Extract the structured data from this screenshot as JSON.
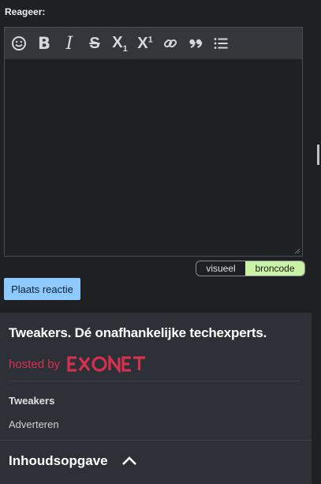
{
  "comment": {
    "label": "Reageer:",
    "toolbar_icons": [
      "emoji-icon",
      "bold-icon",
      "italic-icon",
      "strikethrough-icon",
      "subscript-icon",
      "superscript-icon",
      "link-icon",
      "quote-icon",
      "bulleted-list-icon"
    ],
    "subscript_glyph": "X",
    "subscript_index": "1",
    "superscript_glyph": "X",
    "superscript_index": "1",
    "bold_glyph": "B",
    "italic_glyph": "I",
    "strike_glyph": "S",
    "mode_visual": "visueel",
    "mode_code": "broncode",
    "active_mode": "broncode",
    "submit_label": "Plaats reactie"
  },
  "footer": {
    "tagline": "Tweakers. Dé onafhankelijke techexperts.",
    "hosted_by": "hosted by",
    "host_logo": "EXONET",
    "section_title": "Tweakers",
    "section_link": "Adverteren",
    "toc_title": "Inhoudsopgave"
  },
  "colors": {
    "background": "#1f2023",
    "toolbar": "#33373b",
    "footer": "#2d3037",
    "accent_submit": "#8ec9ff",
    "active_mode": "#c9f2a4",
    "brand_red": "#d6304f"
  }
}
